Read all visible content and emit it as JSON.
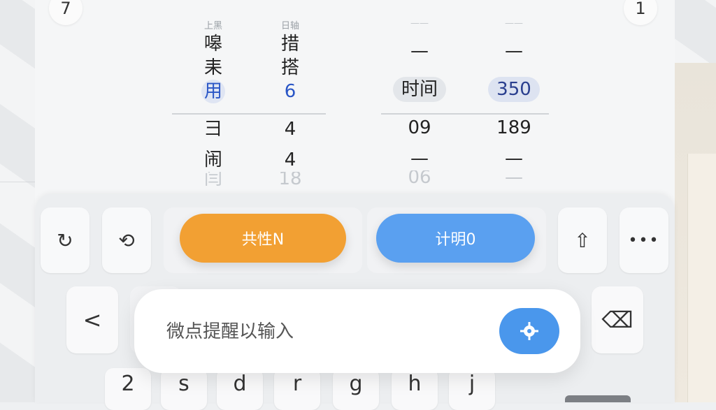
{
  "corners": {
    "left": "7",
    "right": "1"
  },
  "picker": {
    "col1": {
      "header": "上黑",
      "above": [
        "嗥",
        "耒"
      ],
      "selected": "用",
      "below": [
        "彐",
        "闹"
      ],
      "faint": "闫"
    },
    "col2": {
      "header": "日轴",
      "above": [
        "措",
        "搭"
      ],
      "selected": "6",
      "below": [
        "4",
        "4"
      ],
      "faint": "18"
    },
    "col3": {
      "header": "——",
      "above": [
        "—"
      ],
      "selected": "时间",
      "below": [
        "09",
        "—"
      ],
      "faint": "06"
    },
    "col4": {
      "header": "——",
      "above": [
        "—"
      ],
      "selected": "350",
      "below": [
        "189",
        "—"
      ],
      "faint": "—"
    }
  },
  "toolbar": {
    "left_buttons": [
      "↻",
      "⟲"
    ],
    "orange_label": "共性N",
    "blue_label": "计明0",
    "right_buttons": [
      "⇧",
      "•••"
    ]
  },
  "input": {
    "back": "<",
    "placeholder": "微点提醒以输入",
    "delete": "⌫"
  },
  "letters": [
    "2",
    "s",
    "d",
    "r",
    "g",
    "h",
    "j"
  ],
  "colors": {
    "orange": "#f2a033",
    "blue": "#5aa0f0",
    "send": "#4a97ec",
    "selected_text": "#2a56c6"
  }
}
